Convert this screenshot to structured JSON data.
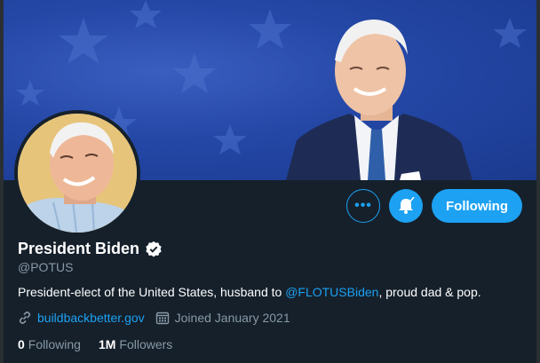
{
  "profile": {
    "name": "President Biden",
    "handle": "@POTUS",
    "bio_prefix": "President-elect of the United States, husband to ",
    "bio_mention": "@FLOTUSBiden",
    "bio_suffix": ", proud dad & pop.",
    "website": "buildbackbetter.gov",
    "joined": "Joined January 2021",
    "following_count": "0",
    "following_label": "Following",
    "followers_count": "1M",
    "followers_label": "Followers"
  },
  "actions": {
    "more_label": "•••",
    "follow_label": "Following"
  },
  "icons": {
    "verified": "verified-badge-icon",
    "link": "link-icon",
    "calendar": "calendar-icon",
    "bell": "bell-icon",
    "more": "more-options-icon"
  },
  "colors": {
    "background": "#15202b",
    "accent": "#1da1f2",
    "muted": "#8899a6",
    "banner": "#2447a6"
  }
}
